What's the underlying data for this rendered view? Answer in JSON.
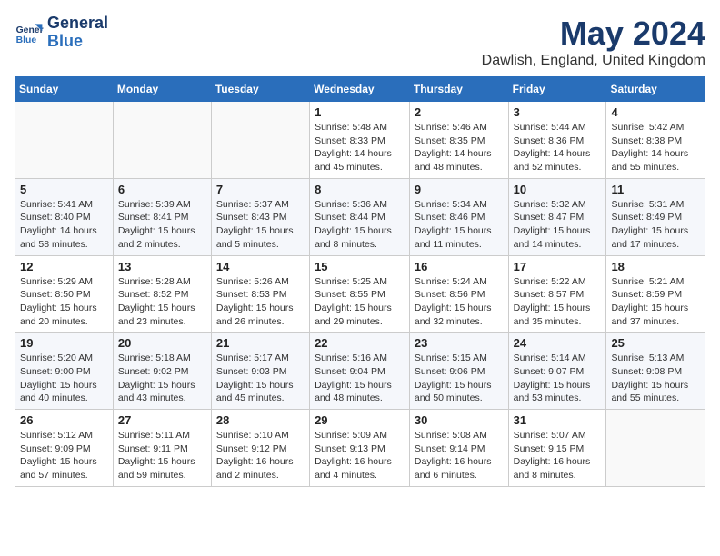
{
  "logo": {
    "line1": "General",
    "line2": "Blue"
  },
  "title": "May 2024",
  "subtitle": "Dawlish, England, United Kingdom",
  "days_of_week": [
    "Sunday",
    "Monday",
    "Tuesday",
    "Wednesday",
    "Thursday",
    "Friday",
    "Saturday"
  ],
  "weeks": [
    [
      {
        "day": "",
        "info": ""
      },
      {
        "day": "",
        "info": ""
      },
      {
        "day": "",
        "info": ""
      },
      {
        "day": "1",
        "info": "Sunrise: 5:48 AM\nSunset: 8:33 PM\nDaylight: 14 hours\nand 45 minutes."
      },
      {
        "day": "2",
        "info": "Sunrise: 5:46 AM\nSunset: 8:35 PM\nDaylight: 14 hours\nand 48 minutes."
      },
      {
        "day": "3",
        "info": "Sunrise: 5:44 AM\nSunset: 8:36 PM\nDaylight: 14 hours\nand 52 minutes."
      },
      {
        "day": "4",
        "info": "Sunrise: 5:42 AM\nSunset: 8:38 PM\nDaylight: 14 hours\nand 55 minutes."
      }
    ],
    [
      {
        "day": "5",
        "info": "Sunrise: 5:41 AM\nSunset: 8:40 PM\nDaylight: 14 hours\nand 58 minutes."
      },
      {
        "day": "6",
        "info": "Sunrise: 5:39 AM\nSunset: 8:41 PM\nDaylight: 15 hours\nand 2 minutes."
      },
      {
        "day": "7",
        "info": "Sunrise: 5:37 AM\nSunset: 8:43 PM\nDaylight: 15 hours\nand 5 minutes."
      },
      {
        "day": "8",
        "info": "Sunrise: 5:36 AM\nSunset: 8:44 PM\nDaylight: 15 hours\nand 8 minutes."
      },
      {
        "day": "9",
        "info": "Sunrise: 5:34 AM\nSunset: 8:46 PM\nDaylight: 15 hours\nand 11 minutes."
      },
      {
        "day": "10",
        "info": "Sunrise: 5:32 AM\nSunset: 8:47 PM\nDaylight: 15 hours\nand 14 minutes."
      },
      {
        "day": "11",
        "info": "Sunrise: 5:31 AM\nSunset: 8:49 PM\nDaylight: 15 hours\nand 17 minutes."
      }
    ],
    [
      {
        "day": "12",
        "info": "Sunrise: 5:29 AM\nSunset: 8:50 PM\nDaylight: 15 hours\nand 20 minutes."
      },
      {
        "day": "13",
        "info": "Sunrise: 5:28 AM\nSunset: 8:52 PM\nDaylight: 15 hours\nand 23 minutes."
      },
      {
        "day": "14",
        "info": "Sunrise: 5:26 AM\nSunset: 8:53 PM\nDaylight: 15 hours\nand 26 minutes."
      },
      {
        "day": "15",
        "info": "Sunrise: 5:25 AM\nSunset: 8:55 PM\nDaylight: 15 hours\nand 29 minutes."
      },
      {
        "day": "16",
        "info": "Sunrise: 5:24 AM\nSunset: 8:56 PM\nDaylight: 15 hours\nand 32 minutes."
      },
      {
        "day": "17",
        "info": "Sunrise: 5:22 AM\nSunset: 8:57 PM\nDaylight: 15 hours\nand 35 minutes."
      },
      {
        "day": "18",
        "info": "Sunrise: 5:21 AM\nSunset: 8:59 PM\nDaylight: 15 hours\nand 37 minutes."
      }
    ],
    [
      {
        "day": "19",
        "info": "Sunrise: 5:20 AM\nSunset: 9:00 PM\nDaylight: 15 hours\nand 40 minutes."
      },
      {
        "day": "20",
        "info": "Sunrise: 5:18 AM\nSunset: 9:02 PM\nDaylight: 15 hours\nand 43 minutes."
      },
      {
        "day": "21",
        "info": "Sunrise: 5:17 AM\nSunset: 9:03 PM\nDaylight: 15 hours\nand 45 minutes."
      },
      {
        "day": "22",
        "info": "Sunrise: 5:16 AM\nSunset: 9:04 PM\nDaylight: 15 hours\nand 48 minutes."
      },
      {
        "day": "23",
        "info": "Sunrise: 5:15 AM\nSunset: 9:06 PM\nDaylight: 15 hours\nand 50 minutes."
      },
      {
        "day": "24",
        "info": "Sunrise: 5:14 AM\nSunset: 9:07 PM\nDaylight: 15 hours\nand 53 minutes."
      },
      {
        "day": "25",
        "info": "Sunrise: 5:13 AM\nSunset: 9:08 PM\nDaylight: 15 hours\nand 55 minutes."
      }
    ],
    [
      {
        "day": "26",
        "info": "Sunrise: 5:12 AM\nSunset: 9:09 PM\nDaylight: 15 hours\nand 57 minutes."
      },
      {
        "day": "27",
        "info": "Sunrise: 5:11 AM\nSunset: 9:11 PM\nDaylight: 15 hours\nand 59 minutes."
      },
      {
        "day": "28",
        "info": "Sunrise: 5:10 AM\nSunset: 9:12 PM\nDaylight: 16 hours\nand 2 minutes."
      },
      {
        "day": "29",
        "info": "Sunrise: 5:09 AM\nSunset: 9:13 PM\nDaylight: 16 hours\nand 4 minutes."
      },
      {
        "day": "30",
        "info": "Sunrise: 5:08 AM\nSunset: 9:14 PM\nDaylight: 16 hours\nand 6 minutes."
      },
      {
        "day": "31",
        "info": "Sunrise: 5:07 AM\nSunset: 9:15 PM\nDaylight: 16 hours\nand 8 minutes."
      },
      {
        "day": "",
        "info": ""
      }
    ]
  ]
}
